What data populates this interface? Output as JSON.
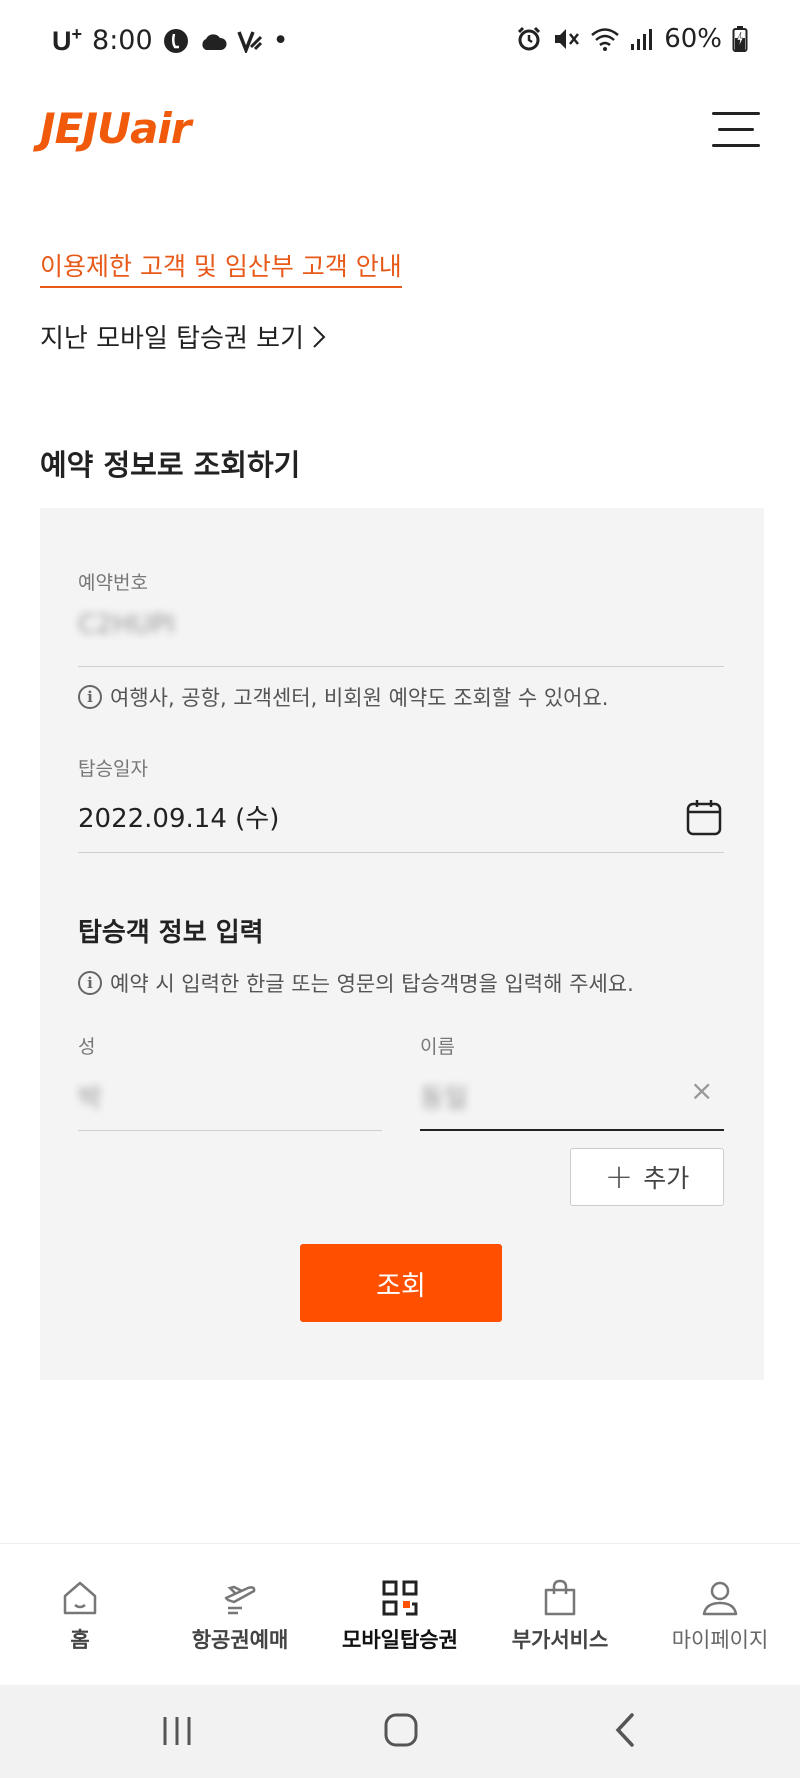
{
  "status_bar": {
    "carrier": "U",
    "carrier_sup": "+",
    "time": "8:00",
    "dot": "•",
    "battery": "60%",
    "icons": [
      "l-circle-icon",
      "cloud-icon",
      "v-app-icon",
      "alarm-icon",
      "mute-icon",
      "wifi-icon",
      "signal-icon",
      "battery-icon"
    ]
  },
  "header": {
    "logo_upper": "JEJU",
    "logo_lower": "air",
    "brand_color": "#f05a0a",
    "menu_icon": "hamburger-menu-icon"
  },
  "links": {
    "notice": "이용제한 고객 및 임산부 고객 안내",
    "past_boarding": "지난 모바일 탑승권 보기"
  },
  "section_title": "예약 정보로 조회하기",
  "form": {
    "reservation_label": "예약번호",
    "reservation_value": "C2HUPI",
    "reservation_info": "여행사, 공항, 고객센터, 비회원 예약도 조회할 수 있어요.",
    "date_label": "탑승일자",
    "date_value": "2022.09.14 (수)",
    "passenger_title": "탑승객 정보 입력",
    "passenger_info": "예약 시 입력한 한글 또는 영문의 탑승객명을 입력해 주세요.",
    "last_name_label": "성",
    "last_name_value": "박",
    "first_name_label": "이름",
    "first_name_value": "동일",
    "clear_icon": "×",
    "add_label": "추가",
    "add_icon": "+",
    "search_label": "조회",
    "accent_color": "#ff5000"
  },
  "bottom_nav": [
    {
      "label": "홈",
      "icon": "home-icon"
    },
    {
      "label": "항공권예매",
      "icon": "airplane-ticket-icon"
    },
    {
      "label": "모바일탑승권",
      "icon": "qr-code-icon",
      "active": true
    },
    {
      "label": "부가서비스",
      "icon": "shopping-bag-icon"
    },
    {
      "label": "마이페이지",
      "icon": "user-icon"
    }
  ],
  "system_nav": [
    "recents-icon",
    "home-circle-icon",
    "back-icon"
  ]
}
